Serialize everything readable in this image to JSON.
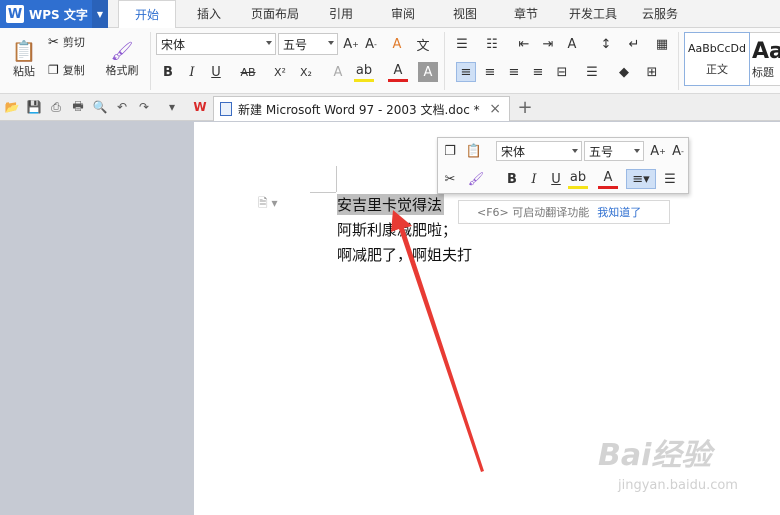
{
  "app": {
    "name": "WPS 文字",
    "logo": "W"
  },
  "menu": {
    "tabs": [
      {
        "label": "开始",
        "active": true
      },
      {
        "label": "插入"
      },
      {
        "label": "页面布局"
      },
      {
        "label": "引用"
      },
      {
        "label": "审阅"
      },
      {
        "label": "视图"
      },
      {
        "label": "章节"
      },
      {
        "label": "开发工具"
      },
      {
        "label": "云服务"
      }
    ]
  },
  "ribbon": {
    "paste_label": "粘贴",
    "cut_label": "剪切",
    "copy_label": "复制",
    "format_painter_label": "格式刷",
    "font_name": "宋体",
    "font_size": "五号",
    "styles": [
      {
        "preview": "AaBbCcDd",
        "label": "正文"
      },
      {
        "preview": "Aa",
        "label": "标题"
      }
    ]
  },
  "document_tab": {
    "title": "新建 Microsoft Word 97 - 2003 文档.doc *"
  },
  "document": {
    "lines": [
      "安吉里卡觉得法",
      "阿斯利康减肥啦；",
      "啊减肥了，啊姐夫打"
    ]
  },
  "mini_toolbar": {
    "font_name": "宋体",
    "font_size": "五号"
  },
  "tooltip": {
    "text": "<F6> 可启动翻译功能",
    "link": "我知道了"
  },
  "watermark": {
    "text": "Bai经验",
    "sub": "jingyan.baidu.com"
  },
  "colors": {
    "accent": "#2f6fd0",
    "arrow": "#e83b34",
    "selection": "#bfbfbf"
  }
}
